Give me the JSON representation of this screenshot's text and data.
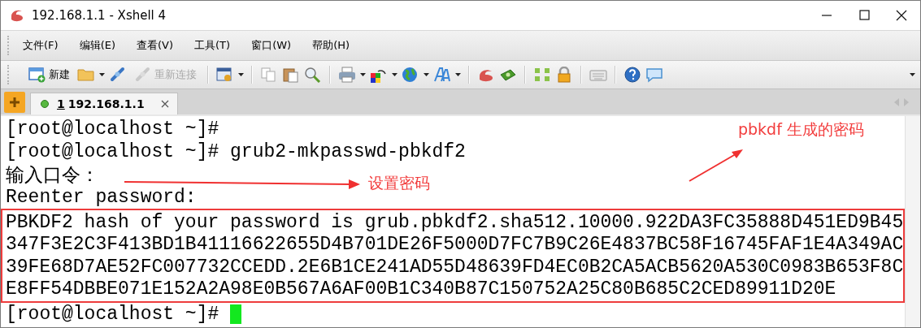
{
  "window": {
    "title": "192.168.1.1 - Xshell 4"
  },
  "menu": [
    {
      "label": "文件(F)"
    },
    {
      "label": "编辑(E)"
    },
    {
      "label": "查看(V)"
    },
    {
      "label": "工具(T)"
    },
    {
      "label": "窗口(W)"
    },
    {
      "label": "帮助(H)"
    }
  ],
  "toolbar": [
    {
      "label": "新建",
      "disabled": false
    },
    {
      "label": "重新连接",
      "disabled": true
    }
  ],
  "tabs": [
    {
      "number": "1",
      "label": "192.168.1.1",
      "selected": true
    }
  ],
  "terminal": {
    "lines": [
      {
        "text": "[root@localhost ~]#",
        "highlighted": false,
        "cursor": false
      },
      {
        "text": "[root@localhost ~]# grub2-mkpasswd-pbkdf2",
        "highlighted": false,
        "cursor": false
      },
      {
        "text": "输入口令：",
        "highlighted": false,
        "cursor": false
      },
      {
        "text": "Reenter password:",
        "highlighted": false,
        "cursor": false
      },
      {
        "text": "PBKDF2 hash of your password is grub.pbkdf2.sha512.10000.922DA3FC35888D451ED9B45",
        "highlighted": true,
        "cursor": false
      },
      {
        "text": "347F3E2C3F413BD1B41116622655D4B701DE26F5000D7FC7B9C26E4837BC58F16745FAF1E4A349AC",
        "highlighted": true,
        "cursor": false
      },
      {
        "text": "39FE68D7AE52FC007732CCEDD.2E6B1CE241AD55D48639FD4EC0B2CA5ACB5620A530C0983B653F8C",
        "highlighted": true,
        "cursor": false
      },
      {
        "text": "E8FF54DBBE071E152A2A98E0B567A6AF00B1C340B87C150752A25C80B685C2CED89911D20E",
        "highlighted": true,
        "cursor": false
      },
      {
        "text": "[root@localhost ~]#",
        "highlighted": false,
        "cursor": true
      }
    ]
  },
  "annotations": [
    {
      "text": "pbkdf 生成的密码",
      "kind": "up-right"
    },
    {
      "text": "设置密码",
      "kind": "right"
    }
  ]
}
